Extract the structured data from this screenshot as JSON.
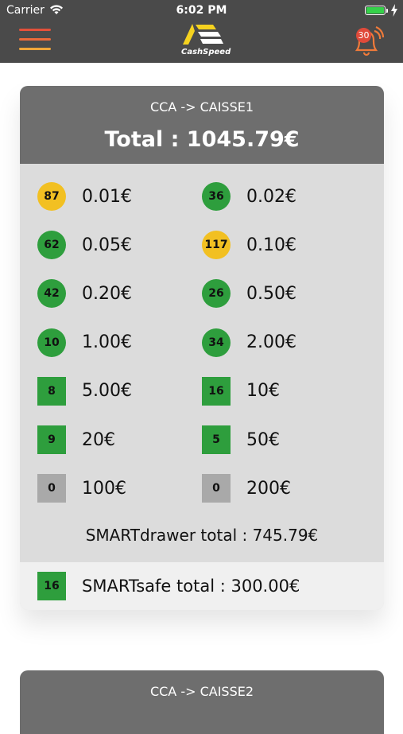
{
  "status_bar": {
    "carrier": "Carrier",
    "time": "6:02 PM"
  },
  "nav": {
    "logo_text": "CashSpeed",
    "notification_count": "30"
  },
  "colors": {
    "nav_bg": "#4a4a4a",
    "card_header": "#6e6e6e",
    "card_body": "#dcdcdc",
    "green": "#2e9e3d",
    "yellow": "#f2c022",
    "gray": "#a9a9a9",
    "menu_red": "#e4513b",
    "menu_orange": "#f1a63a"
  },
  "card1": {
    "title": "CCA -> CAISSE1",
    "total": "Total : 1045.79€",
    "denominations": [
      {
        "count": "87",
        "value": "0.01€",
        "shape": "circle",
        "color": "yellow"
      },
      {
        "count": "36",
        "value": "0.02€",
        "shape": "circle",
        "color": "green"
      },
      {
        "count": "62",
        "value": "0.05€",
        "shape": "circle",
        "color": "green"
      },
      {
        "count": "117",
        "value": "0.10€",
        "shape": "circle",
        "color": "yellow"
      },
      {
        "count": "42",
        "value": "0.20€",
        "shape": "circle",
        "color": "green"
      },
      {
        "count": "26",
        "value": "0.50€",
        "shape": "circle",
        "color": "green"
      },
      {
        "count": "10",
        "value": "1.00€",
        "shape": "circle",
        "color": "green"
      },
      {
        "count": "34",
        "value": "2.00€",
        "shape": "circle",
        "color": "green"
      },
      {
        "count": "8",
        "value": "5.00€",
        "shape": "square",
        "color": "green"
      },
      {
        "count": "16",
        "value": "10€",
        "shape": "square",
        "color": "green"
      },
      {
        "count": "9",
        "value": "20€",
        "shape": "square",
        "color": "green"
      },
      {
        "count": "5",
        "value": "50€",
        "shape": "square",
        "color": "green"
      },
      {
        "count": "0",
        "value": "100€",
        "shape": "square",
        "color": "gray"
      },
      {
        "count": "0",
        "value": "200€",
        "shape": "square",
        "color": "gray"
      }
    ],
    "drawer_total": "SMARTdrawer total : 745.79€",
    "safe": {
      "count": "16",
      "label": "SMARTsafe total : 300.00€"
    }
  },
  "card2": {
    "title": "CCA -> CAISSE2"
  }
}
